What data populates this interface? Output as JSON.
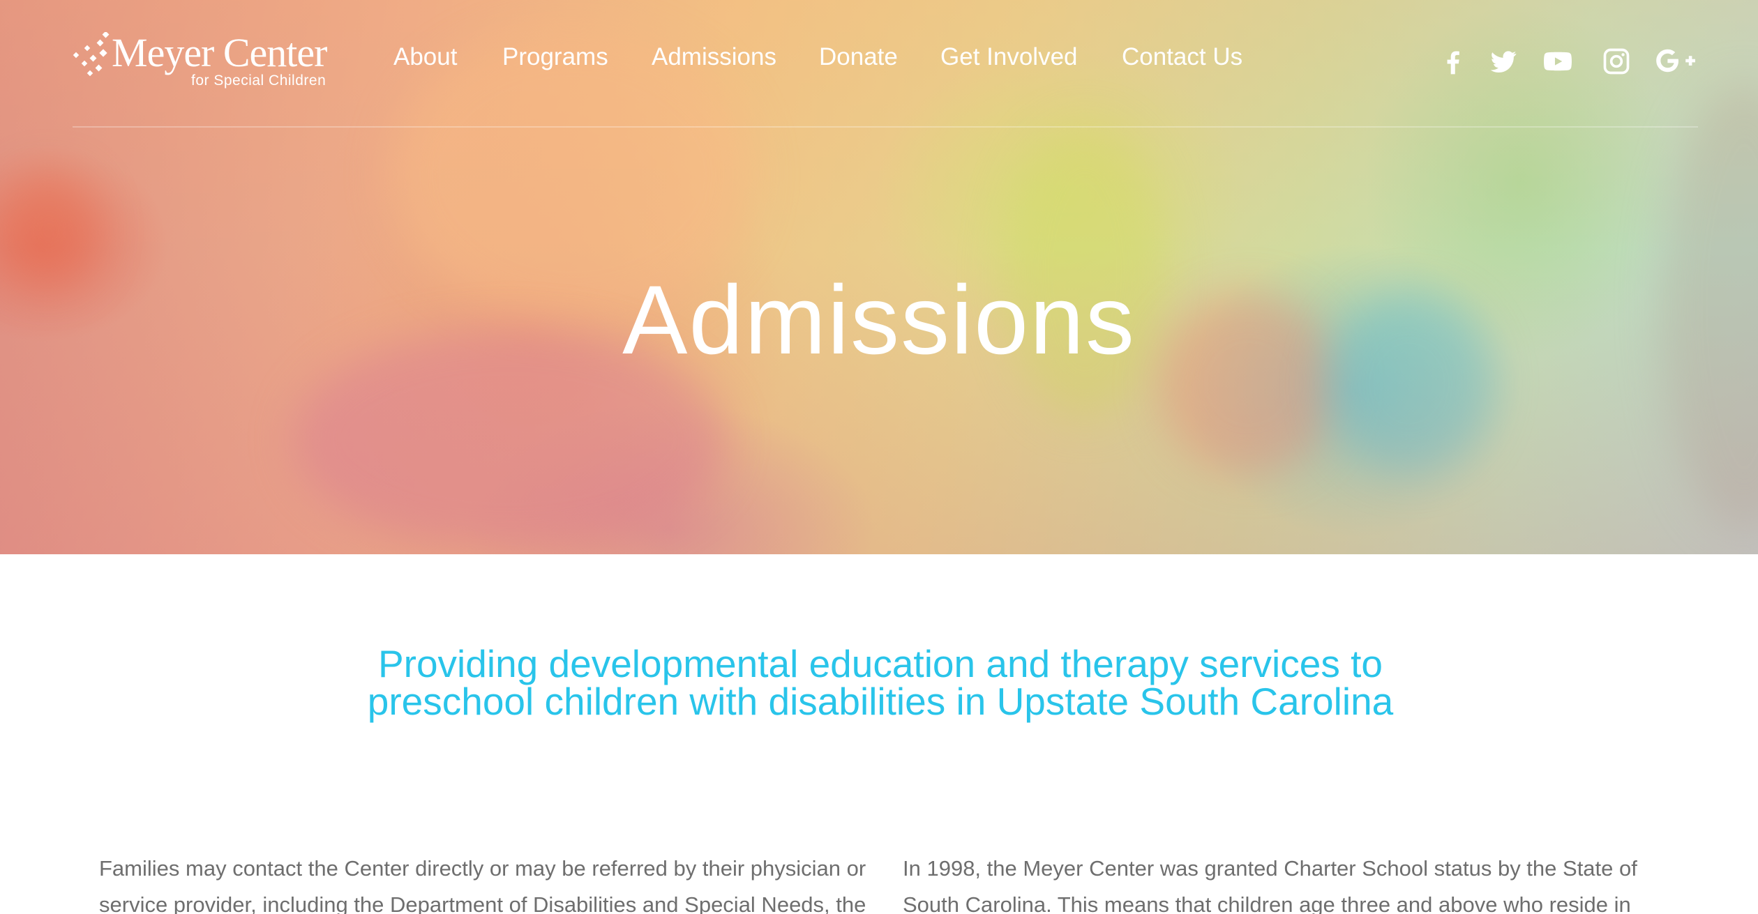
{
  "brand": {
    "name": "Meyer Center",
    "subtitle": "for Special Children"
  },
  "nav": {
    "items": [
      {
        "label": "About"
      },
      {
        "label": "Programs"
      },
      {
        "label": "Admissions"
      },
      {
        "label": "Donate"
      },
      {
        "label": "Get Involved"
      },
      {
        "label": "Contact Us"
      }
    ]
  },
  "social": [
    {
      "icon": "facebook-icon"
    },
    {
      "icon": "twitter-icon"
    },
    {
      "icon": "youtube-icon"
    },
    {
      "icon": "instagram-icon"
    },
    {
      "icon": "google-plus-icon"
    }
  ],
  "hero": {
    "title": "Admissions"
  },
  "content": {
    "tagline": "Providing developmental education and therapy services to preschool children with disabilities in Upstate South Carolina",
    "left_paragraph": "Families may contact the Center directly or may be referred by their physician or service provider, including the Department of Disabilities and Special Needs, the",
    "right_paragraph": "In 1998, the Meyer Center was granted Charter School status by the State of South Carolina.  This means that children age three and above who reside in"
  },
  "colors": {
    "accent": "#29c4ea",
    "body_text": "#6e6e6e",
    "header_text": "#ffffff"
  }
}
